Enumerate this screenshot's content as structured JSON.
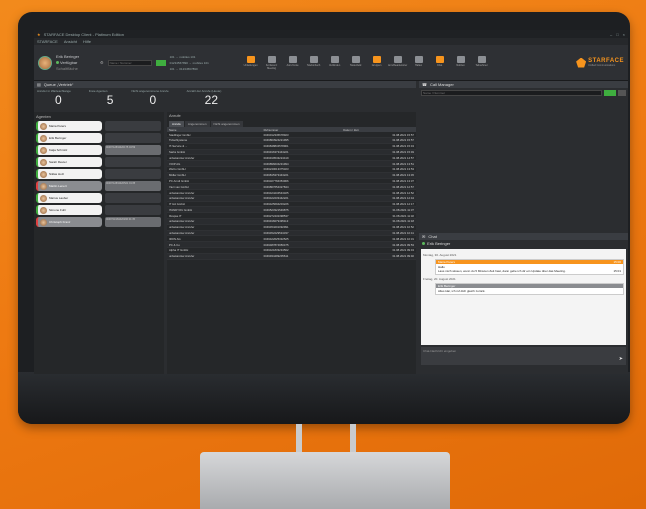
{
  "app": {
    "title": "STARFACE Desktop Client - Platinum Edition",
    "menu": [
      "STARFACE",
      "Ansicht",
      "Hilfe"
    ]
  },
  "user": {
    "name": "Erik Beringer",
    "status": "Verfügbar",
    "sub": "Schaltfläche"
  },
  "toolbar": {
    "search_placeholder": "Name / Nummer",
    "numbers": [
      "101 → mobiles 101",
      "01234567890 → mobiles 101",
      "101 → 01234567890"
    ],
    "icons": [
      {
        "label": "Umleitungen",
        "icon": "redirect-icon",
        "orange": true
      },
      {
        "label": "Konferenz Meeting",
        "icon": "conference-icon",
        "orange": false
      },
      {
        "label": "Anruf Liste",
        "icon": "calllist-icon",
        "orange": false
      },
      {
        "label": "Telefonbuch",
        "icon": "phonebook-icon",
        "orange": false
      },
      {
        "label": "Verbinden",
        "icon": "connect-icon",
        "orange": false
      },
      {
        "label": "Tastenfeld",
        "icon": "keypad-icon",
        "orange": false
      },
      {
        "label": "Gruppen",
        "icon": "groups-icon",
        "orange": true
      },
      {
        "label": "Anrufbeantworter",
        "icon": "voicemail-icon",
        "orange": false
      },
      {
        "label": "Halten",
        "icon": "hold-icon",
        "orange": false
      },
      {
        "label": "Chat",
        "icon": "chat-icon",
        "orange": true
      },
      {
        "label": "Notizen",
        "icon": "notes-icon",
        "orange": false
      },
      {
        "label": "Teilnehmer",
        "icon": "participants-icon",
        "orange": false
      }
    ],
    "logo": "STARFACE",
    "logo_sub": "Unified Communications"
  },
  "queue": {
    "header": "Queue „Vertrieb“",
    "stats": [
      {
        "label": "Anrufer in Warteschlange",
        "value": "0"
      },
      {
        "label": "Freie Agenten",
        "value": "5"
      },
      {
        "label": "Nicht angenommene Anrufe",
        "value": "0"
      },
      {
        "label": "Anzahl der Anrufe (Heute)",
        "value": "22"
      }
    ]
  },
  "agents": {
    "header": "Agenten",
    "items": [
      {
        "name": "Maria Peters",
        "state": "free",
        "call": ""
      },
      {
        "name": "Erik Beringer",
        "state": "free",
        "call": ""
      },
      {
        "name": "Katja Schmitz",
        "state": "free",
        "call": "0049712834420175  04:59"
      },
      {
        "name": "Sarah Reuter",
        "state": "free",
        "call": ""
      },
      {
        "name": "Niklas Holz",
        "state": "free",
        "call": ""
      },
      {
        "name": "Martin Lenert",
        "state": "busy",
        "call": "0049712834420521  01:35"
      },
      {
        "name": "Marius Lauber",
        "state": "free",
        "call": ""
      },
      {
        "name": "Simone Fuhr",
        "state": "free",
        "call": ""
      },
      {
        "name": "Christoph Franz",
        "state": "busy",
        "call": "0049711984420296  01:35"
      }
    ]
  },
  "calls": {
    "header": "Anrufe",
    "tabs": [
      "Anrufe",
      "Angenommen",
      "Nicht angenommen"
    ],
    "columns": [
      "Name",
      "Rufnummer",
      "Datum / Zeit"
    ],
    "rows": [
      [
        "Stadlinger GmbH",
        "0049012345678923",
        "31.08.2021 15:57"
      ],
      [
        "TicketSysteme",
        "0049863924221995",
        "31.08.2021 15:57"
      ],
      [
        "IT-Service & ...",
        "0049848834578901",
        "31.08.2021 15:43"
      ],
      [
        "Sarks GmbH",
        "0049916373443221",
        "31.08.2021 15:49"
      ],
      [
        "unbekannter Anrufer",
        "0049919543224419",
        "31.08.2021 14:57"
      ],
      [
        "VOIP AG",
        "0049896634231994",
        "31.08.2021 13:51"
      ],
      [
        "WeCo GmbH",
        "0049240013375323",
        "31.08.2021 13:53"
      ],
      [
        "Müller GmbH",
        "0049815373443221",
        "31.08.2021 13:45"
      ],
      [
        "PC Arndt GmbH",
        "0049327766353966",
        "31.08.2021 13:37"
      ],
      [
        "Vieri van GmbH",
        "0049867654327844",
        "31.08.2021 12:57"
      ],
      [
        "unbekannter Anrufer",
        "0049424234543325",
        "31.08.2021 12:52"
      ],
      [
        "unbekannter Anrufer",
        "0049422233442221",
        "31.08.2021 12:44"
      ],
      [
        "IT HA GmbH",
        "0049425694203226",
        "31.08.2021 12:17"
      ],
      [
        "ITANDYOU GmbH",
        "0049523321549875",
        "31.08.2021 11:37"
      ],
      [
        "Ibrapse IT",
        "0049272432398537",
        "31.08.2021 11:32"
      ],
      [
        "unbekannter Anrufer",
        "0049918279495113",
        "31.08.2021 11:18"
      ],
      [
        "unbekannter Anrufer",
        "0049454201092991",
        "31.08.2021 10:52"
      ],
      [
        "unbekannter Anrufer",
        "0049452229534337",
        "31.08.2021 10:41"
      ],
      [
        "IRON AG",
        "0049422625332525",
        "31.08.2021 10:31"
      ],
      [
        "PC & Co",
        "0049487874950475",
        "31.08.2021 09:53"
      ],
      [
        "Alpha IT GmbH",
        "0049421833234562",
        "31.08.2021 09:43"
      ],
      [
        "unbekannter Anrufer",
        "0049934499205611",
        "31.08.2021 09:40"
      ]
    ]
  },
  "callmanager": {
    "header": "Call Manager",
    "search_placeholder": "Name / Nummer"
  },
  "chat": {
    "header": "Chat",
    "participant": "Erik Beringer",
    "date1": "Montag, 30. August 2021",
    "msg1": {
      "author": "Maria Peters",
      "time": "15:00",
      "text": "Hallo",
      "text2": "Lass mich wissen, wenn du 5 Minuten Zeit hast, dann gehe ich dir ein Update über das Meeting.",
      "time2": "15:01"
    },
    "date2": "Freitag, 20. August 2021",
    "msg2": {
      "author": "Erik Beringer",
      "text": "Alles klar, ich ruf dich gleich zurück."
    },
    "input_placeholder": "Chat-Nachricht eingeben"
  }
}
